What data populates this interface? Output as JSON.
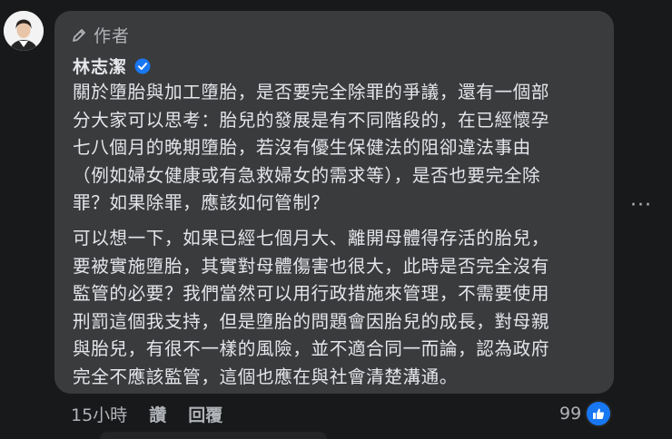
{
  "comment": {
    "badge_label": "作者",
    "author_name": "林志潔",
    "paragraphs": [
      {
        "lines": [
          "關於墮胎與加工墮胎，是否要完全除罪的爭議，還有一個部",
          "分大家可以思考：胎兒的發展是有不同階段的，在已經懷孕",
          "七八個月的晚期墮胎，若沒有優生保健法的阻卻違法事由",
          "（例如婦女健康或有急救婦女的需求等），是否也要完全除",
          "罪？如果除罪，應該如何管制？"
        ]
      },
      {
        "lines": [
          "可以想一下，如果已經七個月大、離開母體得存活的胎兒，",
          "要被實施墮胎，其實對母體傷害也很大，此時是否完全沒有",
          "監管的必要？我們當然可以用行政措施來管理，不需要使用",
          "刑罰這個我支持，但是墮胎的問題會因胎兒的成長，對母親",
          "與胎兒，有很不一樣的風險，並不適合同一而論，認為政府",
          "完全不應該監管，這個也應在與社會清楚溝通。"
        ]
      }
    ],
    "more_label": "···",
    "actions": {
      "time": "15小時",
      "like": "讚",
      "reply": "回覆"
    },
    "reaction_count": "99",
    "colors": {
      "bubble": "#3a3b3c",
      "background": "#18191a",
      "like_blue": "#1877f2"
    },
    "icons": [
      "pencil-icon",
      "verified-badge-icon",
      "like-thumb-icon",
      "more-options-icon"
    ]
  }
}
